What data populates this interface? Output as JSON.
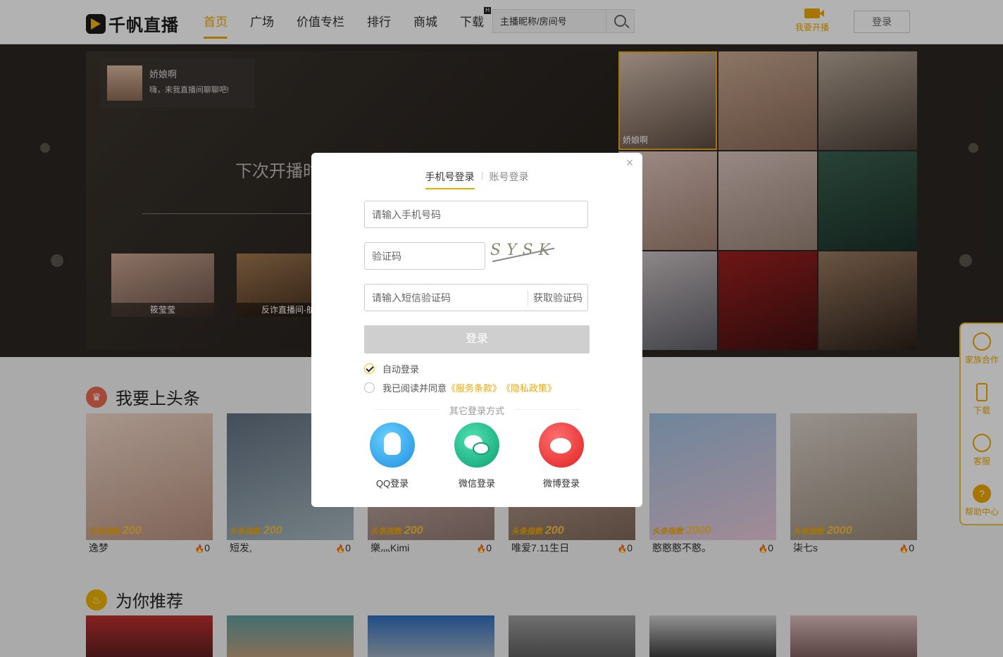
{
  "header": {
    "logo_text": "千帆直播",
    "nav": [
      {
        "label": "首页",
        "active": true
      },
      {
        "label": "广场"
      },
      {
        "label": "价值专栏"
      },
      {
        "label": "排行"
      },
      {
        "label": "商城"
      },
      {
        "label": "下载",
        "badge": "H"
      }
    ],
    "search_placeholder": "主播昵称/房间号",
    "golive_label": "我要开播",
    "login_label": "登录"
  },
  "banner": {
    "chat_name": "娇娘啊",
    "chat_msg": "嗨，来我直播间聊聊吧!",
    "next_live": "下次开播时",
    "anchors": [
      "筱莹莹",
      "反诈直播间-航"
    ],
    "grid_active_caption": "娇娘啊"
  },
  "sections": {
    "headline_title": "我要上头条",
    "recommend_title": "为你推荐",
    "score_label": "头条指数",
    "cards": [
      {
        "name": "逸梦",
        "score": "200",
        "heat": "0"
      },
      {
        "name": "短发,",
        "score": "200",
        "heat": "0"
      },
      {
        "name": "樂灬Kimi",
        "score": "200",
        "heat": "0"
      },
      {
        "name": "唯爱7.11生日",
        "score": "200",
        "heat": "0"
      },
      {
        "name": "憨憨憨不憨。",
        "score": "2000",
        "heat": "0"
      },
      {
        "name": "柒七s",
        "score": "2000",
        "heat": "0"
      }
    ]
  },
  "sidebar": {
    "items": [
      "家族合作",
      "下载",
      "客服",
      "帮助中心"
    ]
  },
  "modal": {
    "tab_phone": "手机号登录",
    "tab_account": "账号登录",
    "phone_placeholder": "请输入手机号码",
    "captcha_placeholder": "验证码",
    "captcha_text": "SYSK",
    "sms_placeholder": "请输入短信验证码",
    "sms_button": "获取验证码",
    "submit": "登录",
    "auto_login": "自动登录",
    "agree_prefix": "我已阅读并同意",
    "terms": "《服务条款》",
    "privacy": "《隐私政策》",
    "other_methods": "其它登录方式",
    "qq_label": "QQ登录",
    "wechat_label": "微信登录",
    "weibo_label": "微博登录"
  },
  "colors": {
    "accent": "#f0a800",
    "qq": "#1e8fe0",
    "wechat": "#0fa072",
    "weibo": "#e02020"
  }
}
